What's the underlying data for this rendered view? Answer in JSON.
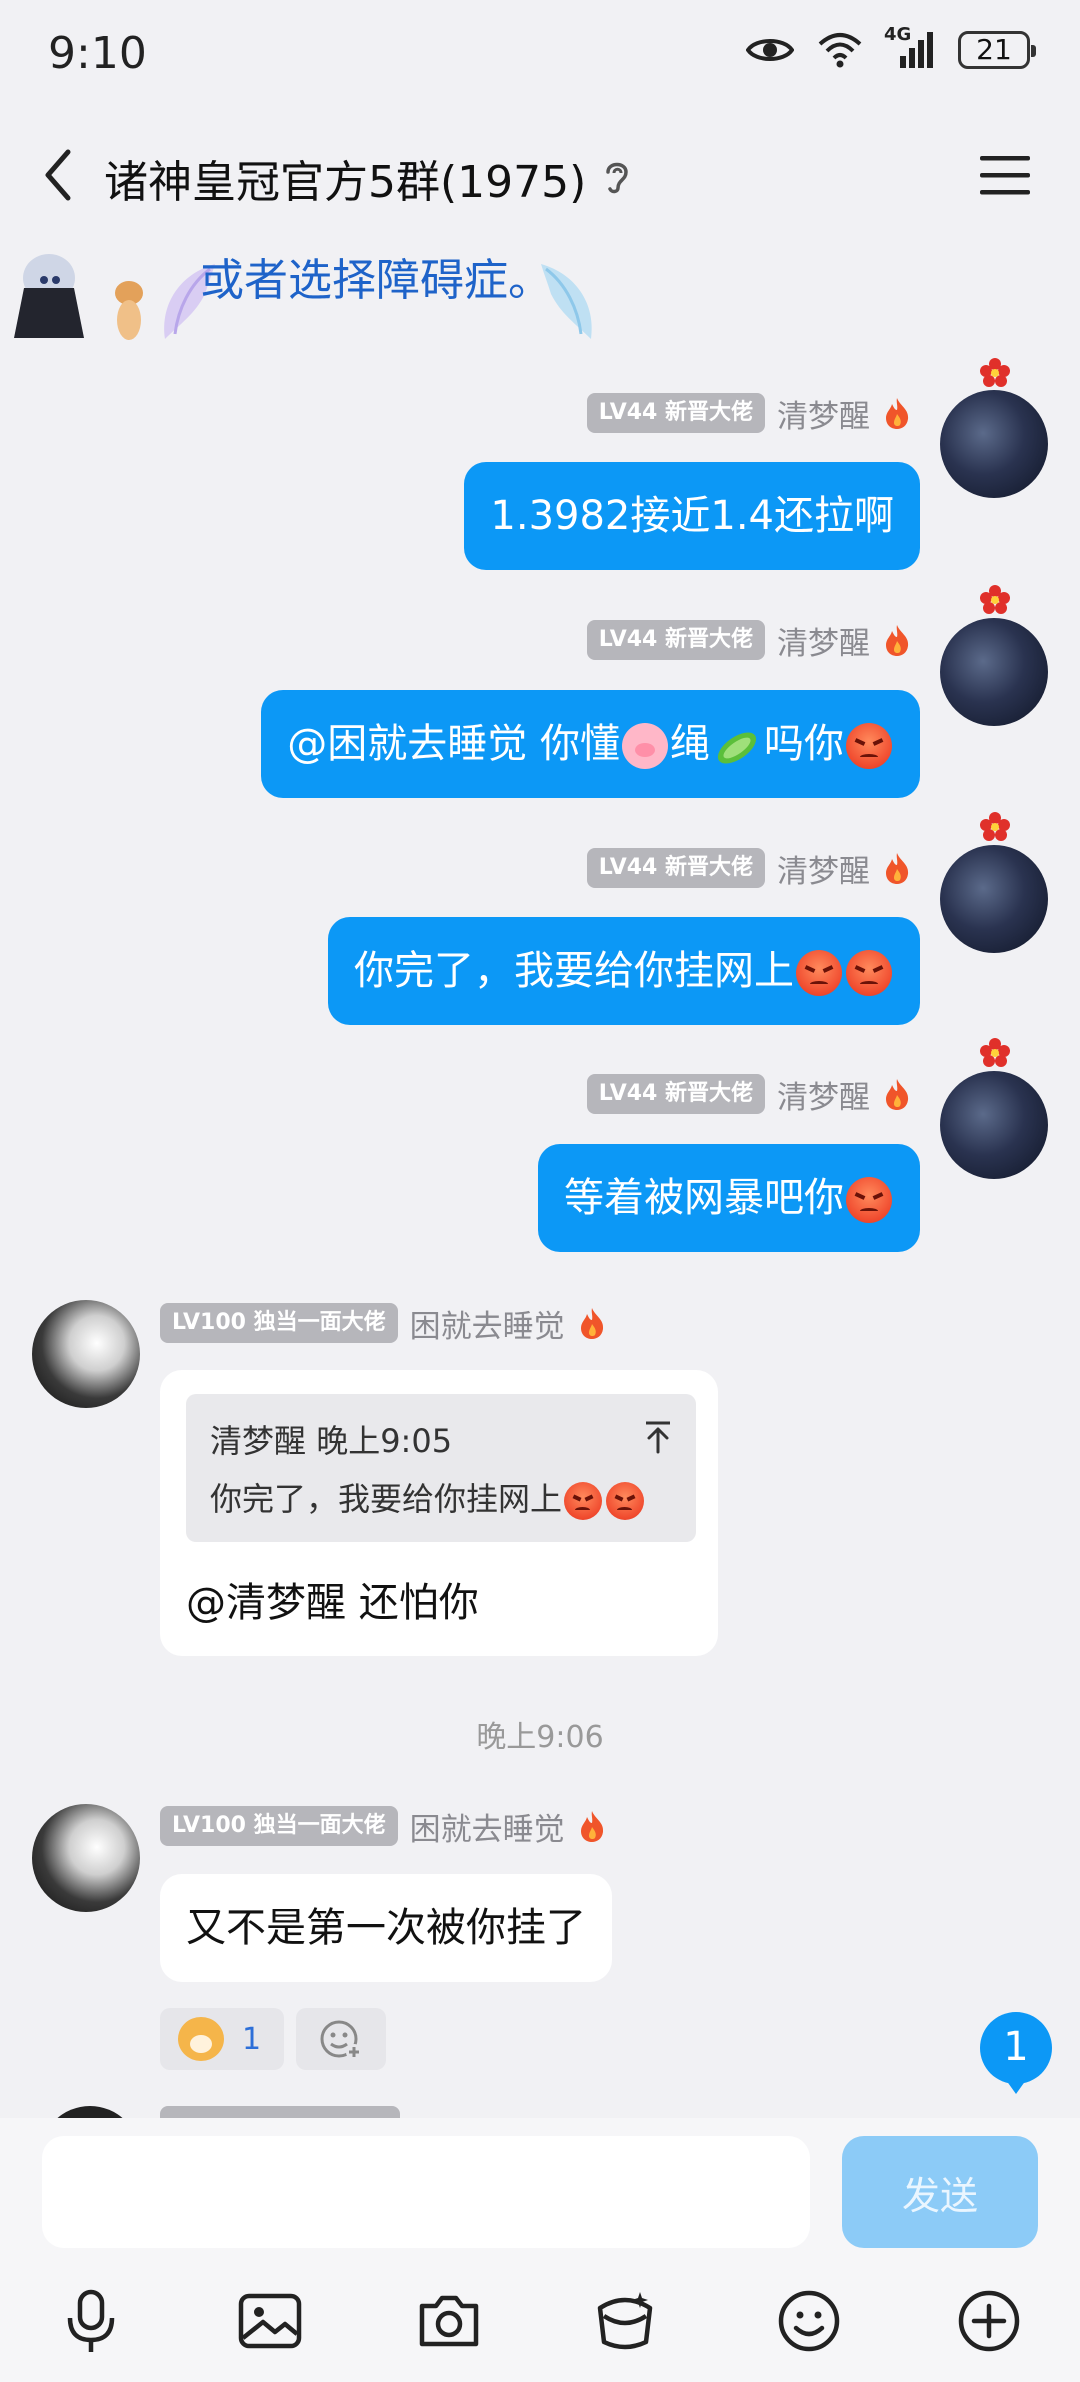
{
  "status_bar": {
    "time": "9:10",
    "network": "4G",
    "battery": "21"
  },
  "header": {
    "title": "诸神皇冠官方5群(1975)"
  },
  "pinned": {
    "text": "或者选择障碍症。"
  },
  "messages": [
    {
      "sender": "清梦醒",
      "level": "LV44 新晋大佬",
      "text": "1.3982接近1.4还拉啊"
    },
    {
      "sender": "清梦醒",
      "level": "LV44 新晋大佬",
      "parts": [
        "@困就去睡觉 你懂",
        "绳",
        "吗你"
      ]
    },
    {
      "sender": "清梦醒",
      "level": "LV44 新晋大佬",
      "text": "你完了，我要给你挂网上"
    },
    {
      "sender": "清梦醒",
      "level": "LV44 新晋大佬",
      "text": "等着被网暴吧你"
    },
    {
      "sender": "困就去睡觉",
      "level": "LV100 独当一面大佬",
      "quote": {
        "sender": "清梦醒",
        "time": "晚上9:05",
        "text": "你完了，我要给你挂网上"
      },
      "text": "@清梦醒 还怕你"
    },
    {
      "sender": "困就去睡觉",
      "level": "LV100 独当一面大佬",
      "text": "又不是第一次被你挂了",
      "reaction_count": "1"
    }
  ],
  "timestamp": "晚上9:06",
  "unread_count": "1",
  "input": {
    "placeholder": "",
    "send_label": "发送"
  },
  "toolbar": [
    "microphone-icon",
    "image-icon",
    "camera-icon",
    "red-packet-icon",
    "emoji-icon",
    "plus-icon"
  ]
}
